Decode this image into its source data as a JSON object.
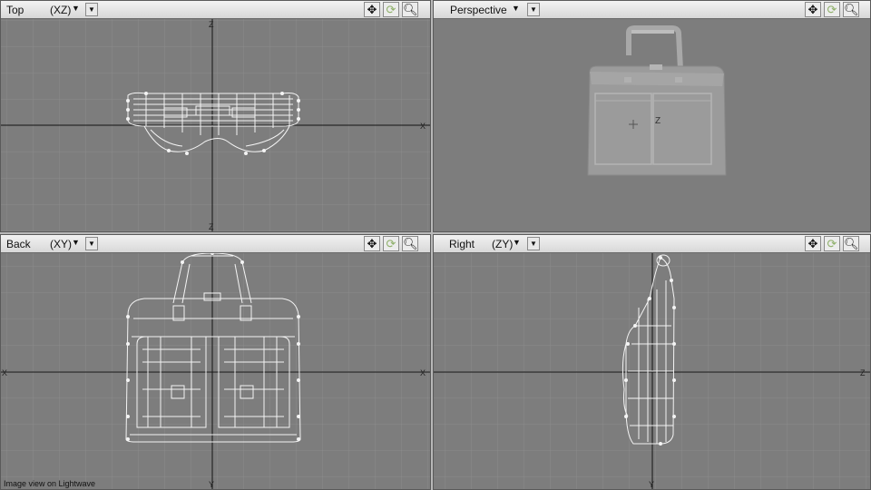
{
  "viewports": {
    "top": {
      "view": "Top",
      "axes": "(XZ)",
      "center_label": "X",
      "left_label": "X",
      "top_label": "Z",
      "bottom_label": "Z"
    },
    "perspective": {
      "view": "Perspective",
      "center_label": "Z"
    },
    "back": {
      "view": "Back",
      "axes": "(XY)",
      "left_label": "X",
      "right_label": "X",
      "bottom_label": "Y"
    },
    "right": {
      "view": "Right",
      "axes": "(ZY)",
      "right_label": "Z",
      "bottom_label": "Y"
    }
  },
  "toolbar_icons": [
    "move-icon",
    "rotate-icon",
    "zoom-icon"
  ],
  "status": {
    "caption": "Image view on Lightwave"
  },
  "colors": {
    "viewport_bg": "#7d7d7d",
    "grid": "#888888",
    "axis": "#1a1a1a",
    "wireframe": "#f4f4f4",
    "header": "#e4e4e4"
  }
}
